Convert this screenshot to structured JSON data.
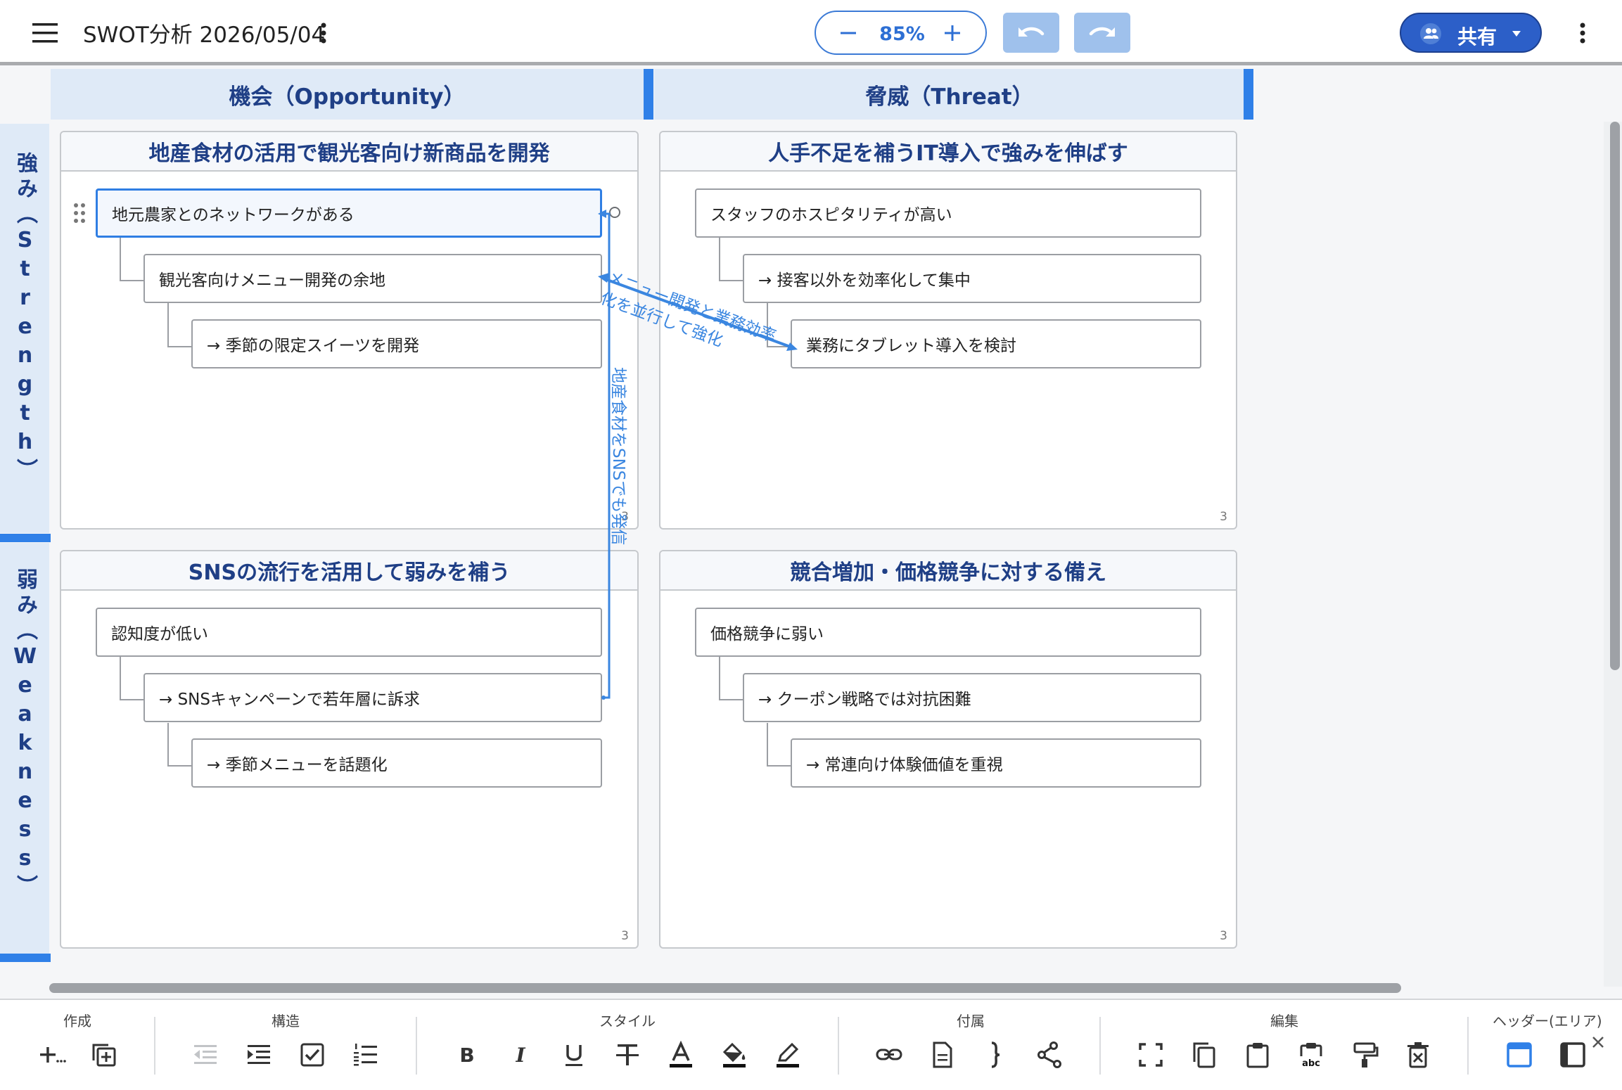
{
  "app": {
    "title": "SWOT分析 2026/05/04",
    "zoom": "85%",
    "share_label": "共有",
    "accent_color": "#2f80e8",
    "share_color": "#2c5fc8"
  },
  "grid": {
    "columns": [
      {
        "label": "機会（Opportunity）"
      },
      {
        "label": "脅威（Threat）"
      }
    ],
    "rows": [
      {
        "label": "強み（Strength）"
      },
      {
        "label": "弱み（Weakness）"
      }
    ]
  },
  "quadrants": {
    "so": {
      "title": "地産食材の活用で観光客向け新商品を開発",
      "count": "3",
      "nodes": [
        "地元農家とのネットワークがある",
        "観光客向けメニュー開発の余地",
        "→ 季節の限定スイーツを開発"
      ]
    },
    "st": {
      "title": "人手不足を補うIT導入で強みを伸ばす",
      "count": "3",
      "nodes": [
        "スタッフのホスピタリティが高い",
        "→ 接客以外を効率化して集中",
        "業務にタブレット導入を検討"
      ]
    },
    "wo": {
      "title": "SNSの流行を活用して弱みを補う",
      "count": "3",
      "nodes": [
        "認知度が低い",
        "→ SNSキャンペーンで若年層に訴求",
        "→ 季節メニューを話題化"
      ]
    },
    "wt": {
      "title": "競合増加・価格競争に対する備え",
      "count": "3",
      "nodes": [
        "価格競争に弱い",
        "→ クーポン戦略では対抗困難",
        "→ 常連向け体験価値を重視"
      ]
    }
  },
  "links": [
    {
      "label_line1": "メニュー開発と業務効率",
      "label_line2": "化を並行して強化"
    },
    {
      "label": "地産食材をSNSでも発信"
    }
  ],
  "toolbar": {
    "groups": [
      {
        "label": "作成",
        "buttons": [
          "add-node-icon",
          "duplicate-node-icon"
        ]
      },
      {
        "label": "構造",
        "buttons": [
          "outdent-icon",
          "indent-icon",
          "checkbox-icon",
          "numbered-list-icon"
        ]
      },
      {
        "label": "スタイル",
        "buttons": [
          "bold-icon",
          "italic-icon",
          "underline-icon",
          "strikethrough-icon",
          "text-color-icon",
          "fill-color-icon",
          "highlight-pen-icon"
        ]
      },
      {
        "label": "付属",
        "buttons": [
          "link-icon",
          "note-icon",
          "brace-icon",
          "relation-icon"
        ]
      },
      {
        "label": "編集",
        "buttons": [
          "select-area-icon",
          "copy-icon",
          "paste-icon",
          "paste-text-icon",
          "format-painter-icon",
          "delete-icon"
        ]
      },
      {
        "label": "ヘッダー(エリア)",
        "buttons": [
          "header-row-icon",
          "header-column-icon"
        ]
      }
    ]
  }
}
